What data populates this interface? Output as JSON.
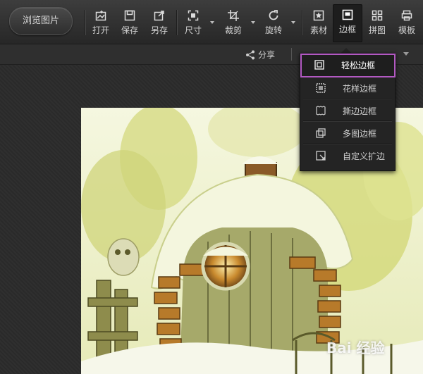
{
  "toolbar": {
    "browse_label": "浏览图片",
    "tools": [
      {
        "label": "打开",
        "icon": "open-icon"
      },
      {
        "label": "保存",
        "icon": "save-icon"
      },
      {
        "label": "另存",
        "icon": "save-as-icon"
      },
      {
        "label": "尺寸",
        "icon": "resize-icon"
      },
      {
        "label": "裁剪",
        "icon": "crop-icon"
      },
      {
        "label": "旋转",
        "icon": "rotate-icon"
      },
      {
        "label": "素材",
        "icon": "material-icon"
      },
      {
        "label": "边框",
        "icon": "border-icon",
        "active": true
      },
      {
        "label": "拼图",
        "icon": "collage-icon"
      },
      {
        "label": "模板",
        "icon": "template-icon"
      }
    ]
  },
  "subbar": {
    "share_label": "分享"
  },
  "border_menu": {
    "items": [
      {
        "label": "轻松边框",
        "icon": "simple-border-icon",
        "selected": true
      },
      {
        "label": "花样边框",
        "icon": "pattern-border-icon"
      },
      {
        "label": "撕边边框",
        "icon": "torn-edge-border-icon"
      },
      {
        "label": "多图边框",
        "icon": "multi-image-border-icon"
      },
      {
        "label": "自定义扩边",
        "icon": "custom-extend-border-icon"
      }
    ]
  },
  "canvas": {
    "watermark": "Bai 经验"
  },
  "colors": {
    "highlight_border": "#b259c2",
    "toolbar_bg": "#333333",
    "menu_bg": "#242424"
  }
}
